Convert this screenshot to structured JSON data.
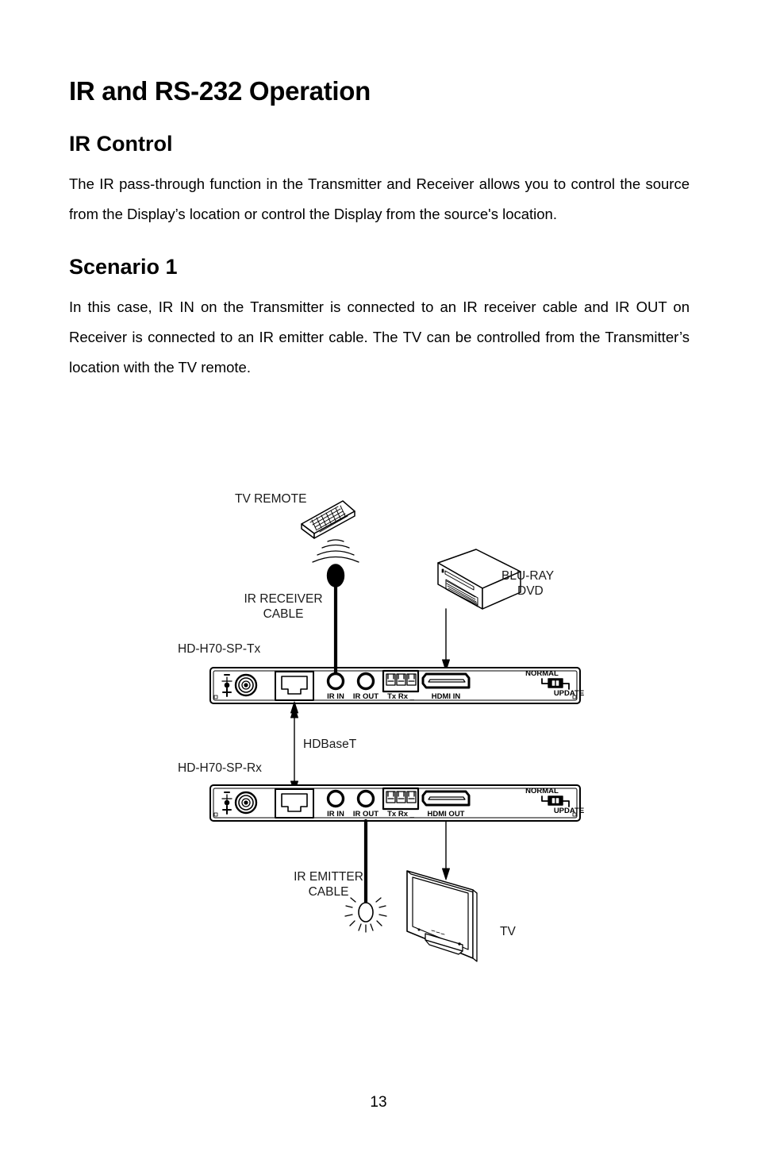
{
  "document": {
    "title": "IR and RS-232 Operation",
    "page_number": "13"
  },
  "sections": [
    {
      "heading": "IR Control",
      "paragraph": "The IR pass-through function in the Transmitter and Receiver allows you to control the source from the Display’s location or control the Display from the source's location."
    },
    {
      "heading": "Scenario 1",
      "paragraph": "In this case, IR IN on the Transmitter is connected to an IR receiver cable and IR OUT on Receiver is connected to an IR emitter cable. The TV can be controlled from the Transmitter’s location with the TV remote."
    }
  ],
  "diagram": {
    "labels": {
      "tv_remote": "TV REMOTE",
      "ir_receiver_cable_line1": "IR RECEIVER",
      "ir_receiver_cable_line2": "CABLE",
      "bluray_line1": "BLU-RAY",
      "bluray_line2": "DVD",
      "transmitter_model": "HD-H70-SP-Tx",
      "receiver_model": "HD-H70-SP-Rx",
      "link": "HDBaseT",
      "ir_emitter_cable_line1": "IR EMITTER",
      "ir_emitter_cable_line2": "CABLE",
      "tv": "TV"
    },
    "transmitter_panel": {
      "ports": [
        {
          "id": "power",
          "label": ""
        },
        {
          "id": "rj45",
          "label": ""
        },
        {
          "id": "ir-in",
          "label": "IR IN"
        },
        {
          "id": "ir-out",
          "label": "IR OUT"
        },
        {
          "id": "rs232",
          "label": "Tx Rx ÷"
        },
        {
          "id": "hdmi-in",
          "label": "HDMI IN"
        }
      ],
      "switch": {
        "top_label": "NORMAL",
        "bottom_label": "UPDATE"
      }
    },
    "receiver_panel": {
      "ports": [
        {
          "id": "power",
          "label": ""
        },
        {
          "id": "rj45",
          "label": ""
        },
        {
          "id": "ir-in",
          "label": "IR IN"
        },
        {
          "id": "ir-out",
          "label": "IR OUT"
        },
        {
          "id": "rs232",
          "label": "Tx Rx ÷"
        },
        {
          "id": "hdmi-out",
          "label": "HDMI OUT"
        }
      ],
      "switch": {
        "top_label": "NORMAL",
        "bottom_label": "UPDATE"
      }
    },
    "colors": {
      "ink": "#000000",
      "paper": "#ffffff"
    }
  }
}
